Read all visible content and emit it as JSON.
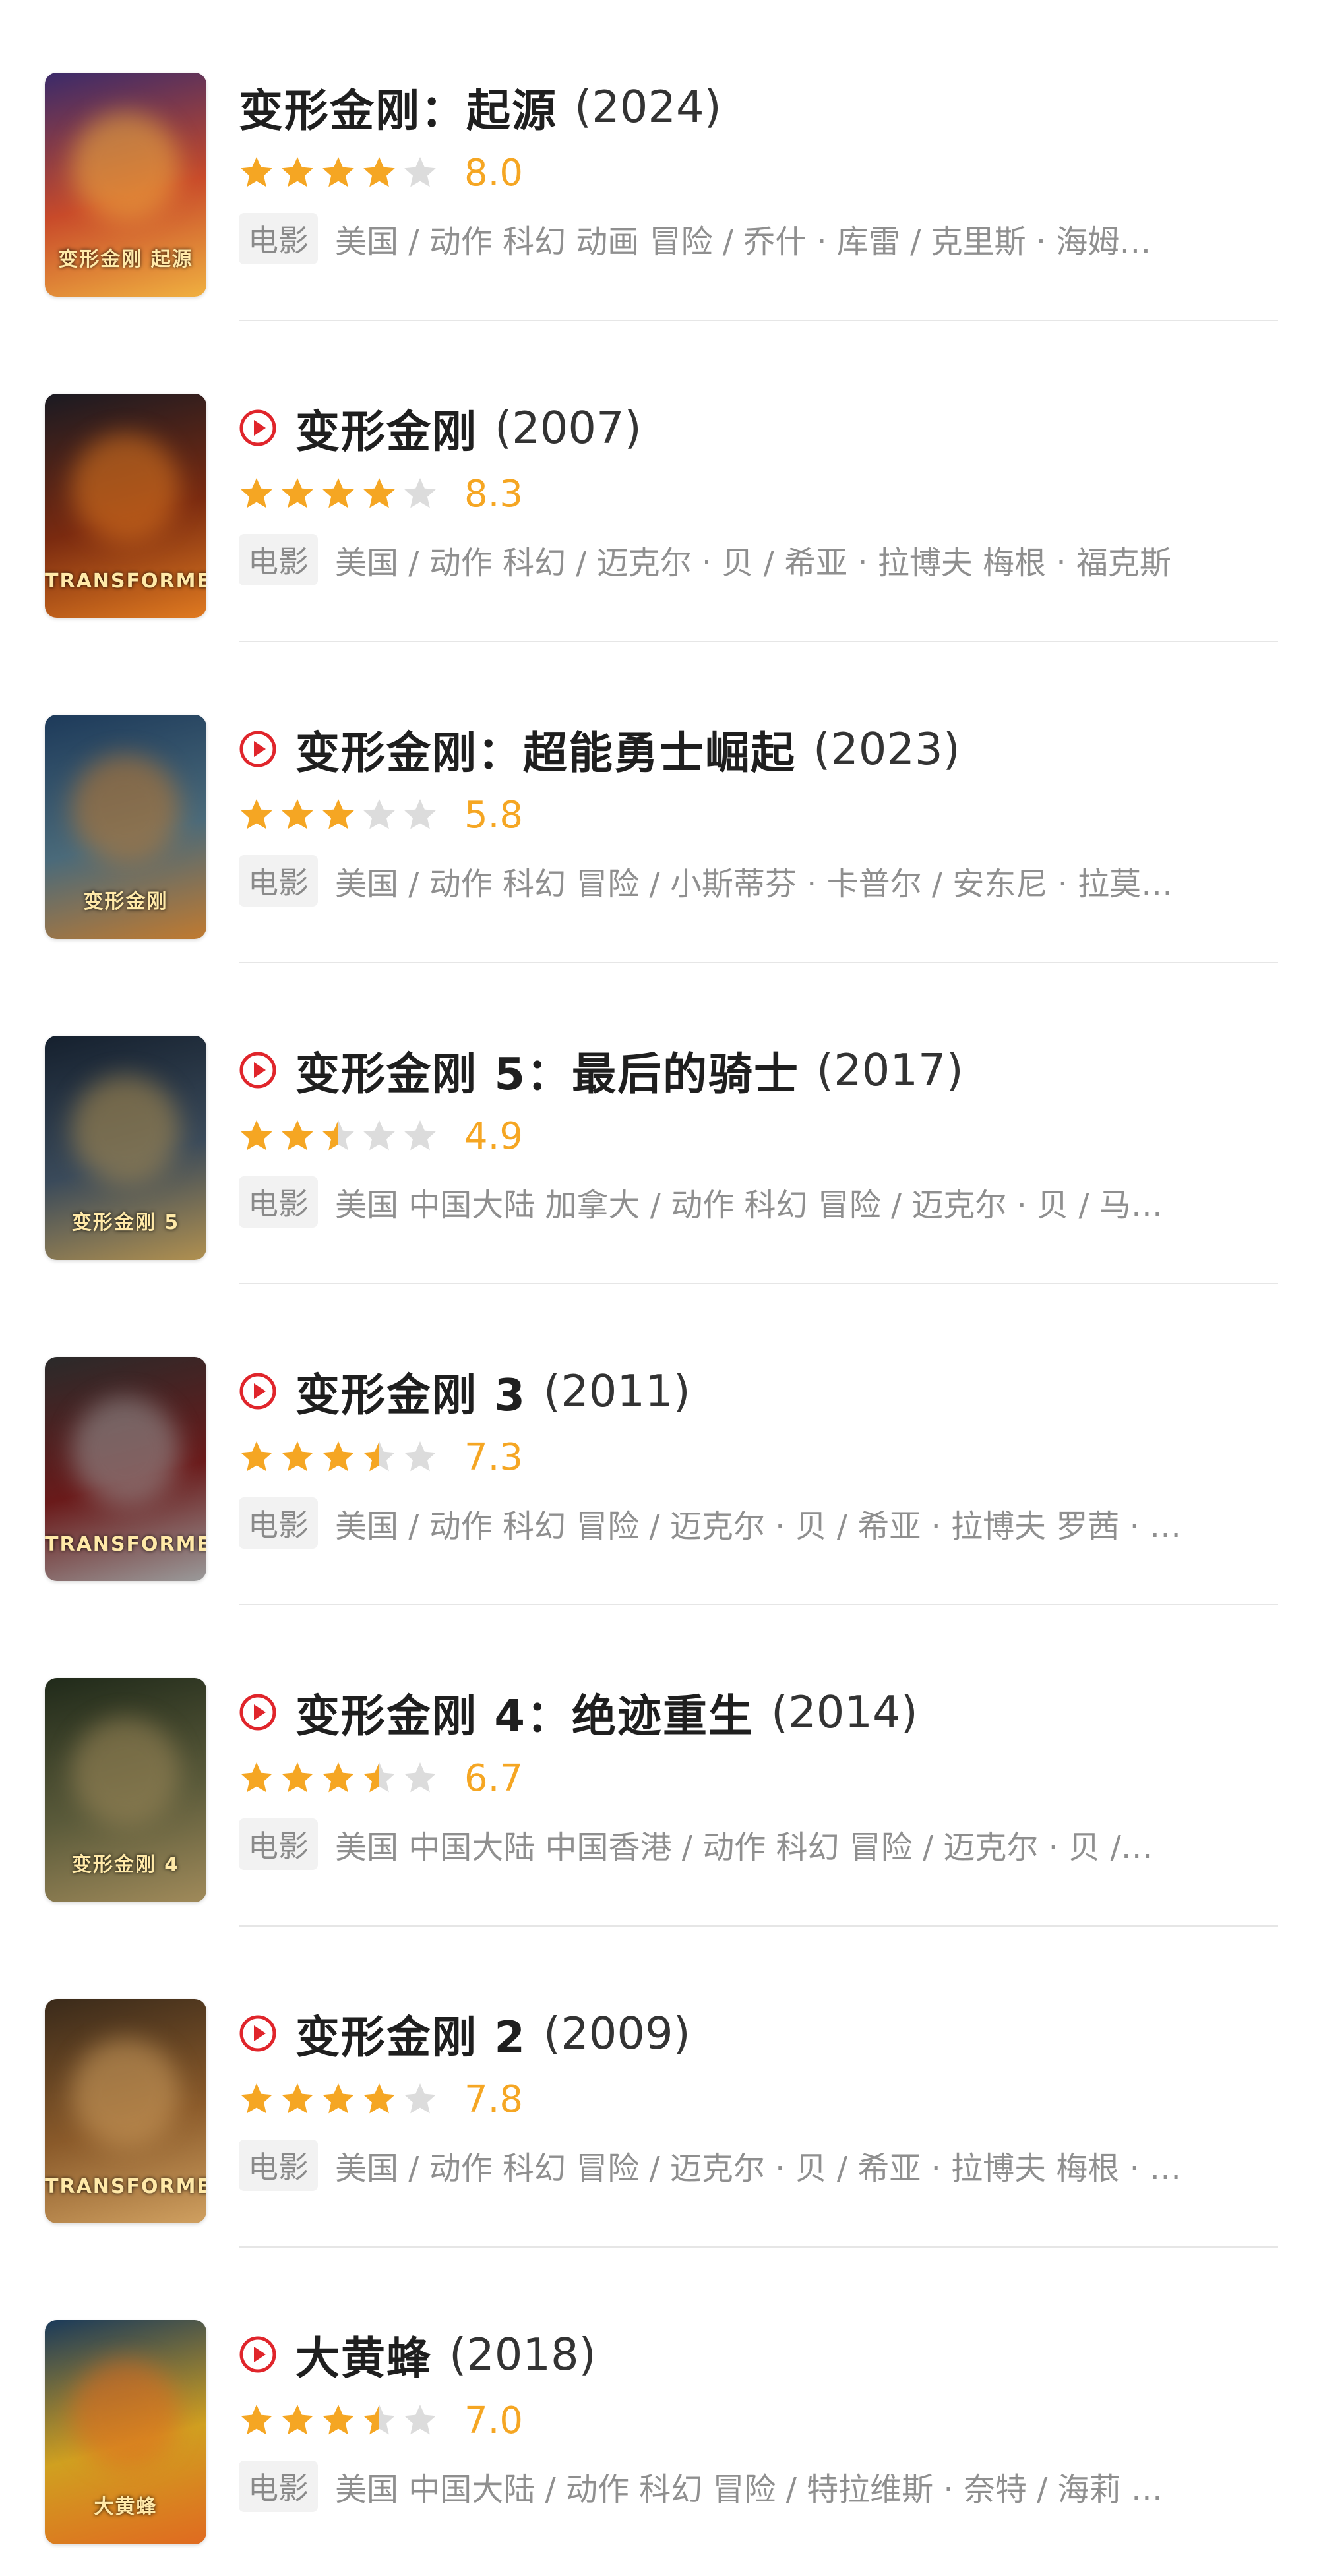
{
  "colors": {
    "accent_red": "#e0252b",
    "star_yellow": "#f5a623",
    "star_empty": "#dcdcdc",
    "meta_gray": "#8f8f8f"
  },
  "items": [
    {
      "title": "变形金刚：起源",
      "year": "(2024)",
      "has_play": false,
      "rating": 4,
      "score": "8.0",
      "badge": "电影",
      "meta": "美国 / 动作 科幻 动画 冒险 / 乔什 · 库雷 / 克里斯 · 海姆…",
      "poster_text": "变形金刚 起源",
      "poster_colors": [
        "#3a2a6a",
        "#c84a2a",
        "#f0b040"
      ]
    },
    {
      "title": "变形金刚",
      "year": "(2007)",
      "has_play": true,
      "rating": 4,
      "score": "8.3",
      "badge": "电影",
      "meta": "美国 / 动作 科幻 / 迈克尔 · 贝 / 希亚 · 拉博夫 梅根 · 福克斯",
      "poster_text": "TRANSFORMERS",
      "poster_colors": [
        "#1a1a22",
        "#7a2a10",
        "#e07a20"
      ]
    },
    {
      "title": "变形金刚：超能勇士崛起",
      "year": "(2023)",
      "has_play": true,
      "rating": 3,
      "score": "5.8",
      "badge": "电影",
      "meta": "美国 / 动作 科幻 冒险 / 小斯蒂芬 · 卡普尔 / 安东尼 · 拉莫…",
      "poster_text": "变形金刚",
      "poster_colors": [
        "#1d3a5a",
        "#4a6a7a",
        "#c07a30"
      ]
    },
    {
      "title": "变形金刚 5：最后的骑士",
      "year": "(2017)",
      "has_play": true,
      "rating": 2.5,
      "score": "4.9",
      "badge": "电影",
      "meta": "美国 中国大陆 加拿大 / 动作 科幻 冒险 / 迈克尔 · 贝 / 马…",
      "poster_text": "变形金刚 5",
      "poster_colors": [
        "#15202e",
        "#3a4a5a",
        "#b09050"
      ]
    },
    {
      "title": "变形金刚 3",
      "year": "(2011)",
      "has_play": true,
      "rating": 3.5,
      "score": "7.3",
      "badge": "电影",
      "meta": "美国 / 动作 科幻 冒险 / 迈克尔 · 贝 / 希亚 · 拉博夫 罗茜 · …",
      "poster_text": "TRANSFORMERS",
      "poster_colors": [
        "#2a2a2a",
        "#6a1a1a",
        "#9a9a9a"
      ]
    },
    {
      "title": "变形金刚 4：绝迹重生",
      "year": "(2014)",
      "has_play": true,
      "rating": 3.5,
      "score": "6.7",
      "badge": "电影",
      "meta": "美国 中国大陆 中国香港 / 动作 科幻 冒险 / 迈克尔 · 贝 /…",
      "poster_text": "变形金刚 4",
      "poster_colors": [
        "#202a1a",
        "#5a5a3a",
        "#a08a5a"
      ]
    },
    {
      "title": "变形金刚 2",
      "year": "(2009)",
      "has_play": true,
      "rating": 4,
      "score": "7.8",
      "badge": "电影",
      "meta": "美国 / 动作 科幻 冒险 / 迈克尔 · 贝 / 希亚 · 拉博夫 梅根 · …",
      "poster_text": "TRANSFORMERS",
      "poster_colors": [
        "#3a2a1a",
        "#8a5a2a",
        "#d0a060"
      ]
    },
    {
      "title": "大黄蜂",
      "year": "(2018)",
      "has_play": true,
      "rating": 3.5,
      "score": "7.0",
      "badge": "电影",
      "meta": "美国 中国大陆 / 动作 科幻 冒险 / 特拉维斯 · 奈特 / 海莉 …",
      "poster_text": "大黄蜂",
      "poster_colors": [
        "#1a3a5a",
        "#d0a020",
        "#e06a20"
      ]
    }
  ]
}
